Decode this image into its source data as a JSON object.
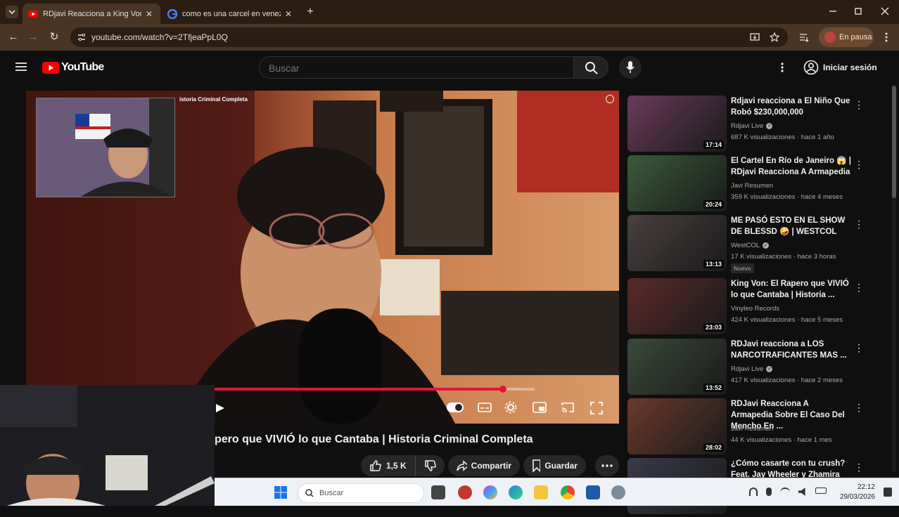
{
  "browser": {
    "tabs": [
      {
        "title": "RDjavi Reacciona a King Von: El"
      },
      {
        "title": "como es una carcel en venezue"
      }
    ],
    "url": "youtube.com/watch?v=2TfjeaPpL0Q",
    "paused_label": "En pausa"
  },
  "youtube": {
    "logo_text": "YouTube",
    "search_placeholder": "Buscar",
    "signin_label": "Iniciar sesión"
  },
  "player": {
    "inner_title": "istoria Criminal Completa",
    "progress_fraction": 0.9
  },
  "video": {
    "title": "pero que VIVIÓ lo que Cantaba | Historia Criminal Completa",
    "likes": "1,5 K",
    "share_label": "Compartir",
    "save_label": "Guardar"
  },
  "recommendations": [
    {
      "title": "Rdjavi reacciona a El Niño Que Robó $230,000,000",
      "channel": "Rdjavi Live",
      "verified": true,
      "meta": "687 K visualizaciones · hace 1 año",
      "duration": "17:14",
      "badge": "",
      "color": "#6a3a5a"
    },
    {
      "title": "El Cartel En Río de Janeiro 😱 | RDjavi Reacciona A Armapedia",
      "channel": "Javi Resumen",
      "verified": false,
      "meta": "359 K visualizaciones · hace 4 meses",
      "duration": "20:24",
      "badge": "",
      "color": "#3a5a3a"
    },
    {
      "title": "ME PASÓ ESTO EN EL SHOW DE BLESSD 🤪 | WESTCOL",
      "channel": "WestCOL",
      "verified": true,
      "meta": "17 K visualizaciones · hace 3 horas",
      "duration": "13:13",
      "badge": "Nuevo",
      "color": "#4a4040"
    },
    {
      "title": "King Von: El Rapero que VIVIÓ lo que Cantaba | Historia ...",
      "channel": "Vinyleo Records",
      "verified": false,
      "meta": "424 K visualizaciones · hace 5 meses",
      "duration": "23:03",
      "badge": "",
      "color": "#5a2a2a"
    },
    {
      "title": "RDJavi reacciona a LOS NARCOTRAFICANTES MAS ...",
      "channel": "Rdjavi Live",
      "verified": true,
      "meta": "417 K visualizaciones · hace 2 meses",
      "duration": "13:52",
      "badge": "",
      "color": "#3a4a3a"
    },
    {
      "title": "RDJavi Reacciona A Armapedia Sobre El Caso Del Mencho En ...",
      "channel": "Javi Resumen",
      "verified": false,
      "meta": "44 K visualizaciones · hace 1 mes",
      "duration": "28:02",
      "badge": "",
      "color": "#6a3a2a"
    },
    {
      "title": "¿Cómo casarte con tu crush? Feat. Jay Wheeler y Zhamira",
      "channel": "",
      "verified": false,
      "meta": "",
      "duration": "",
      "badge": "",
      "color": "#3a3a4a"
    }
  ],
  "taskbar": {
    "search_placeholder": "Buscar",
    "time": "22:12",
    "date": "29/03/2026"
  }
}
